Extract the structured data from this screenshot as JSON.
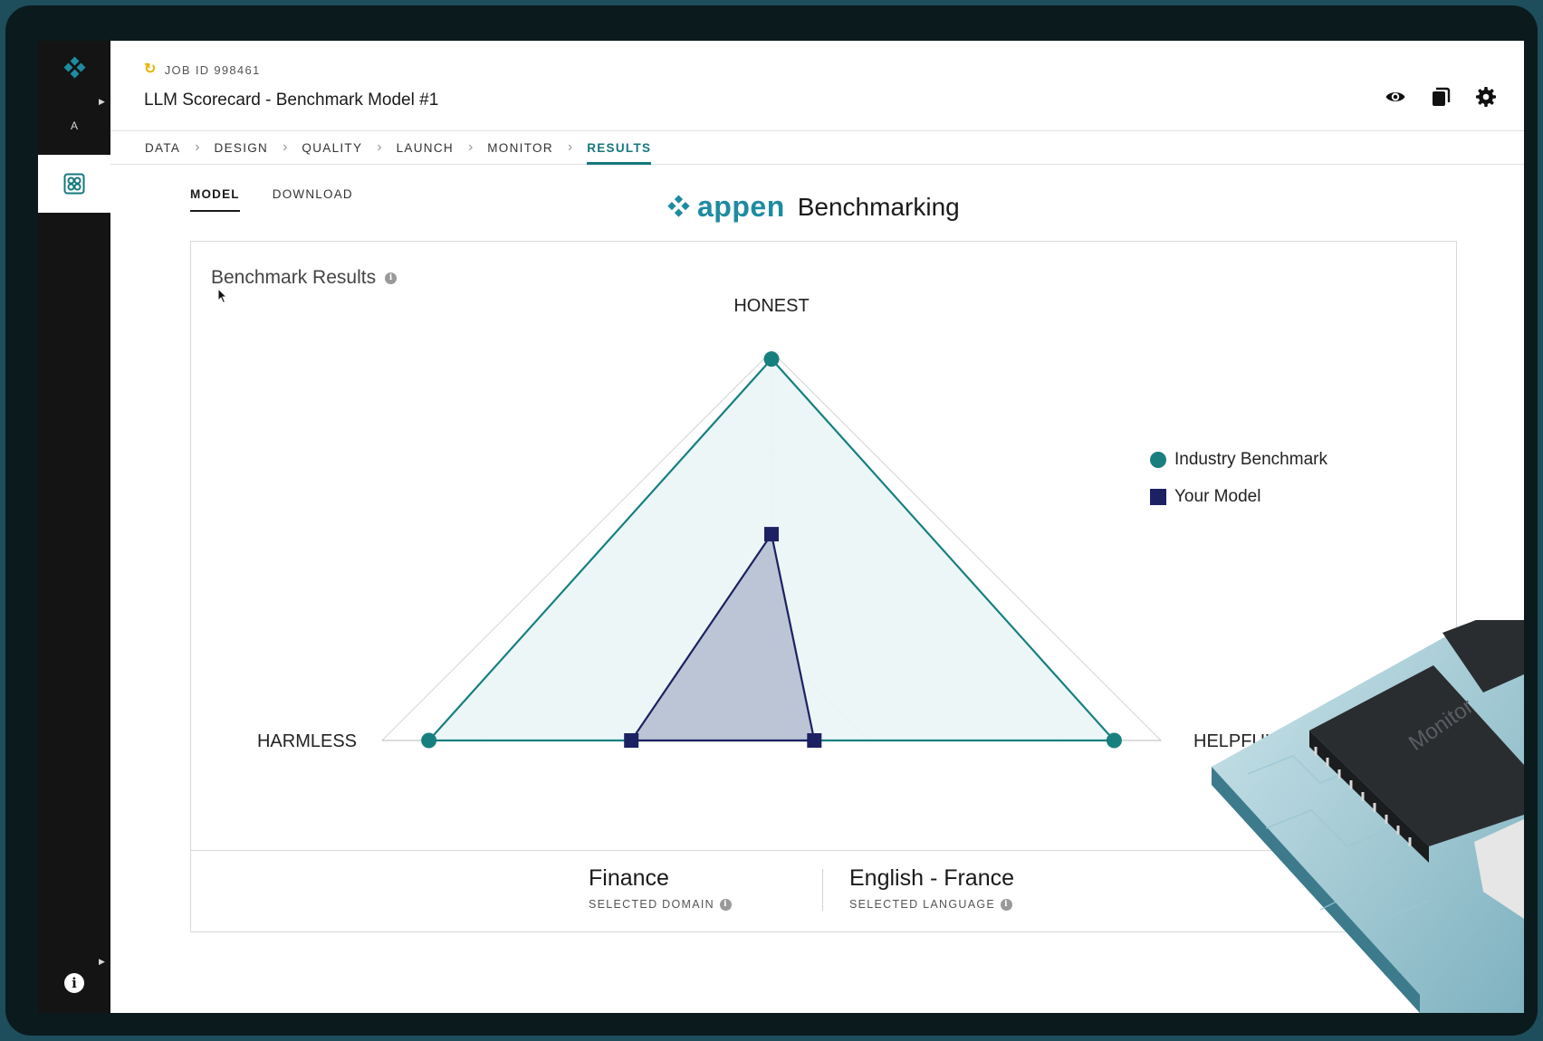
{
  "sidebar": {
    "letter": "A"
  },
  "header": {
    "job_id": "JOB ID 998461",
    "title": "LLM Scorecard - Benchmark Model #1"
  },
  "steps": [
    "DATA",
    "DESIGN",
    "QUALITY",
    "LAUNCH",
    "MONITOR",
    "RESULTS"
  ],
  "active_step": "RESULTS",
  "subtabs": [
    "MODEL",
    "DOWNLOAD"
  ],
  "brand": {
    "logo": "appen",
    "word": "Benchmarking"
  },
  "card": {
    "title": "Benchmark Results"
  },
  "chart_data": {
    "type": "radar",
    "axes": [
      "HONEST",
      "HELPFUL",
      "HARMLESS"
    ],
    "levels": 4,
    "max": 100,
    "series": [
      {
        "name": "Industry Benchmark",
        "values": [
          98,
          88,
          88
        ],
        "color": "#17807f",
        "fill": "#ebf6f6",
        "marker": "circle"
      },
      {
        "name": "Your Model",
        "values": [
          53,
          11,
          36
        ],
        "color": "#1c2163",
        "fill": "#b6c0d2",
        "marker": "square"
      }
    ]
  },
  "footer": {
    "domain_value": "Finance",
    "domain_label": "SELECTED DOMAIN",
    "language_value": "English - France",
    "language_label": "SELECTED LANGUAGE"
  },
  "decor": {
    "chip_label": "Monitor"
  },
  "colors": {
    "accent": "#15787e",
    "benchmark": "#17807f",
    "model": "#1c2163",
    "brand": "#1e8ba1"
  }
}
